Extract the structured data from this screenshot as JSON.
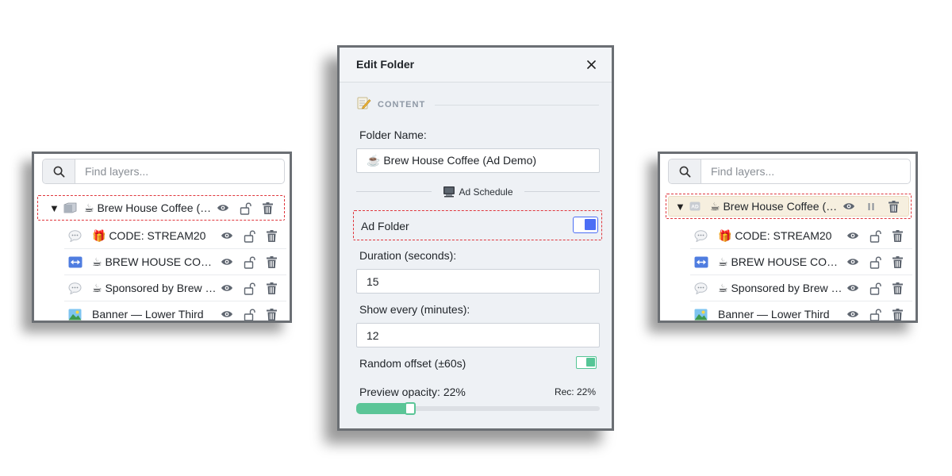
{
  "colors": {
    "accent_blue": "#4c6ef5",
    "accent_green": "#5bc597",
    "highlight_dash": "#e0363c",
    "ad_folder_row_bg": "#f6efdf"
  },
  "left_panel": {
    "search_placeholder": "Find layers...",
    "folder": {
      "caret": "▼",
      "icon": "folder-icon",
      "label": "☕ Brew House Coffee (Ad Demo)"
    },
    "children": [
      {
        "icon": "chat-bubble-icon",
        "label": "🎁 CODE: STREAM20"
      },
      {
        "icon": "scroll-arrows-icon",
        "label": "☕ BREW HOUSE COFFEE"
      },
      {
        "icon": "chat-bubble-icon",
        "label": "☕ Sponsored by Brew House Coffee"
      },
      {
        "icon": "image-icon",
        "label": "Banner — Lower Third"
      }
    ]
  },
  "right_panel": {
    "search_placeholder": "Find layers...",
    "folder": {
      "caret": "▼",
      "icon": "ad-badge-icon",
      "label": "☕ Brew House Coffee (Ad Demo)"
    },
    "children": [
      {
        "icon": "chat-bubble-icon",
        "label": "🎁 CODE: STREAM20"
      },
      {
        "icon": "scroll-arrows-icon",
        "label": "☕ BREW HOUSE COFFEE"
      },
      {
        "icon": "chat-bubble-icon",
        "label": "☕ Sponsored by Brew House Coffee"
      },
      {
        "icon": "image-icon",
        "label": "Banner — Lower Third"
      }
    ]
  },
  "dialog": {
    "title": "Edit Folder",
    "section_title": "CONTENT",
    "folder_name_label": "Folder Name:",
    "folder_name_value": "☕ Brew House Coffee (Ad Demo)",
    "ad_schedule_label": "Ad Schedule",
    "ad_folder_label": "Ad Folder",
    "ad_folder_checked": true,
    "duration_label": "Duration (seconds):",
    "duration_value": "15",
    "show_every_label": "Show every (minutes):",
    "show_every_value": "12",
    "random_offset_label": "Random offset (±60s)",
    "random_offset_checked": true,
    "preview_opacity_label": "Preview opacity: 22%",
    "preview_opacity_value": 22,
    "rec_label": "Rec: 22%"
  }
}
